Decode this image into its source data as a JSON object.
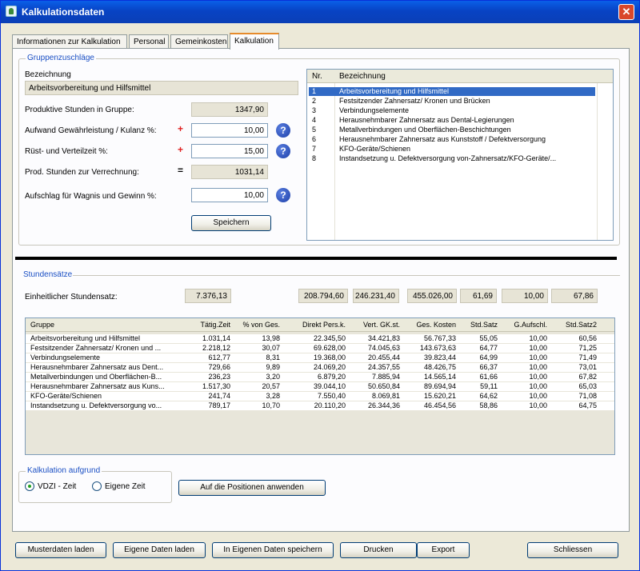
{
  "window": {
    "title": "Kalkulationsdaten",
    "close_glyph": "✕"
  },
  "tabs": [
    {
      "label": "Informationen zur Kalkulation"
    },
    {
      "label": "Personal"
    },
    {
      "label": "Gemeinkosten"
    },
    {
      "label": "Kalkulation"
    }
  ],
  "groups": {
    "label": "Gruppenzuschläge",
    "bezeichnung_label": "Bezeichnung",
    "bezeichnung_value": "Arbeitsvorbereitung und Hilfsmittel",
    "produktive_label": "Produktive Stunden in Gruppe:",
    "produktive_value": "1347,90",
    "aufwand_label": "Aufwand Gewährleistung / Kulanz %:",
    "aufwand_op": "+",
    "aufwand_value": "10,00",
    "rust_label": "Rüst- und Verteilzeit %:",
    "rust_op": "+",
    "rust_value": "15,00",
    "prod_label": "Prod. Stunden zur Verrechnung:",
    "prod_op": "=",
    "prod_value": "1031,14",
    "aufschlag_label": "Aufschlag für Wagnis und Gewinn %:",
    "aufschlag_value": "10,00",
    "help_glyph": "?",
    "save_label": "Speichern"
  },
  "group_list": {
    "col_nr": "Nr.",
    "col_bez": "Bezeichnung",
    "items": [
      {
        "nr": "1",
        "name": "Arbeitsvorbereitung und Hilfsmittel"
      },
      {
        "nr": "2",
        "name": "Festsitzender Zahnersatz/ Kronen und Brücken"
      },
      {
        "nr": "3",
        "name": "Verbindungselemente"
      },
      {
        "nr": "4",
        "name": "Herausnehmbarer Zahnersatz aus Dental-Legierungen"
      },
      {
        "nr": "5",
        "name": "Metallverbindungen und Oberflächen-Beschichtungen"
      },
      {
        "nr": "6",
        "name": "Herausnehmbarer Zahnersatz aus Kunststoff / Defektversorgung"
      },
      {
        "nr": "7",
        "name": "KFO-Geräte/Schienen"
      },
      {
        "nr": "8",
        "name": "Instandsetzung u. Defektversorgung von-Zahnersatz/KFO-Geräte/..."
      }
    ]
  },
  "rates": {
    "label": "Stundensätze",
    "einheitlicher_label": "Einheitlicher Stundensatz:",
    "einheitlicher_value": "7.376,13",
    "totals": [
      "208.794,60",
      "246.231,40",
      "455.026,00",
      "61,69",
      "10,00",
      "67,86"
    ]
  },
  "table": {
    "columns": [
      "Gruppe",
      "Tätig.Zeit",
      "% von Ges.",
      "Direkt Pers.k.",
      "Vert. GK.st.",
      "Ges. Kosten",
      "Std.Satz",
      "G.Aufschl.",
      "Std.Satz2"
    ],
    "rows": [
      [
        "Arbeitsvorbereitung und Hilfsmittel",
        "1.031,14",
        "13,98",
        "22.345,50",
        "34.421,83",
        "56.767,33",
        "55,05",
        "10,00",
        "60,56"
      ],
      [
        "Festsitzender Zahnersatz/ Kronen und ...",
        "2.218,12",
        "30,07",
        "69.628,00",
        "74.045,63",
        "143.673,63",
        "64,77",
        "10,00",
        "71,25"
      ],
      [
        "Verbindungselemente",
        "612,77",
        "8,31",
        "19.368,00",
        "20.455,44",
        "39.823,44",
        "64,99",
        "10,00",
        "71,49"
      ],
      [
        "Herausnehmbarer Zahnersatz aus Dent...",
        "729,66",
        "9,89",
        "24.069,20",
        "24.357,55",
        "48.426,75",
        "66,37",
        "10,00",
        "73,01"
      ],
      [
        "Metallverbindungen und Oberflächen-B...",
        "236,23",
        "3,20",
        "6.879,20",
        "7.885,94",
        "14.565,14",
        "61,66",
        "10,00",
        "67,82"
      ],
      [
        "Herausnehmbarer Zahnersatz aus Kuns...",
        "1.517,30",
        "20,57",
        "39.044,10",
        "50.650,84",
        "89.694,94",
        "59,11",
        "10,00",
        "65,03"
      ],
      [
        "KFO-Geräte/Schienen",
        "241,74",
        "3,28",
        "7.550,40",
        "8.069,81",
        "15.620,21",
        "64,62",
        "10,00",
        "71,08"
      ],
      [
        "Instandsetzung u. Defektversorgung vo...",
        "789,17",
        "10,70",
        "20.110,20",
        "26.344,36",
        "46.454,56",
        "58,86",
        "10,00",
        "64,75"
      ]
    ]
  },
  "calc_basis": {
    "label": "Kalkulation aufgrund",
    "option1": "VDZI - Zeit",
    "option2": "Eigene Zeit",
    "apply_label": "Auf die Positionen anwenden"
  },
  "footer": {
    "musterdaten": "Musterdaten laden",
    "eigene_laden": "Eigene Daten laden",
    "eigene_speichern": "In Eigenen Daten speichern",
    "drucken": "Drucken",
    "export": "Export",
    "schliessen": "Schliessen"
  }
}
